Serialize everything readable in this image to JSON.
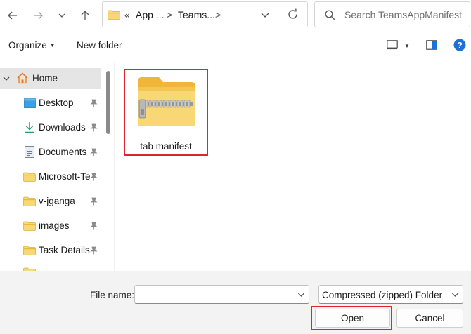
{
  "address_bar": {
    "overflow_marker": "«",
    "crumbs": [
      "App ...",
      "Teams..."
    ],
    "separator": ">"
  },
  "search": {
    "placeholder": "Search TeamsAppManifest"
  },
  "toolbar": {
    "organize_label": "Organize",
    "new_folder_label": "New folder"
  },
  "nav_tree": [
    {
      "label": "Home",
      "icon": "home-icon",
      "selected": true,
      "expanded": true
    },
    {
      "label": "Desktop",
      "icon": "desktop-icon",
      "pinned": true
    },
    {
      "label": "Downloads",
      "icon": "download-icon",
      "pinned": true
    },
    {
      "label": "Documents",
      "icon": "document-icon",
      "pinned": true
    },
    {
      "label": "Microsoft-Te",
      "icon": "folder-icon",
      "pinned": true
    },
    {
      "label": "v-jganga",
      "icon": "folder-icon",
      "pinned": true
    },
    {
      "label": "images",
      "icon": "folder-icon",
      "pinned": true
    },
    {
      "label": "Task Details",
      "icon": "folder-icon",
      "pinned": true
    }
  ],
  "files": [
    {
      "name": "tab manifest",
      "icon": "zip-folder-icon",
      "highlighted": true
    }
  ],
  "footer": {
    "file_name_label": "File name:",
    "file_name_value": "",
    "file_type_value": "Compressed (zipped) Folder",
    "open_label": "Open",
    "cancel_label": "Cancel"
  },
  "colors": {
    "highlight_outline": "#d9262f",
    "folder_yellow": "#f8d775",
    "help_blue": "#1e6fd9",
    "selection_bg": "#e5e5e5"
  }
}
